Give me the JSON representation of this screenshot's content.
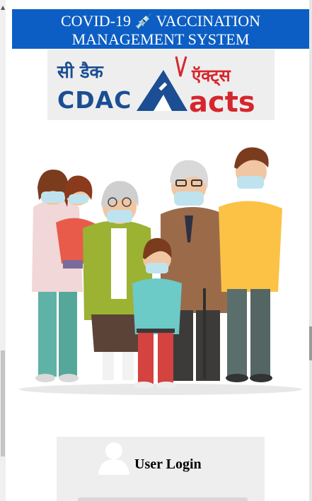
{
  "app": {
    "header_line1": "COVID-19",
    "header_line1b": "VACCINATION",
    "header_line2": "MANAGEMENT SYSTEM"
  },
  "logos": {
    "cdac_hindi": "सी डैक",
    "cdac_english": "CDAC",
    "acts_hindi": "ऍक्ट्स",
    "acts_english": "acts"
  },
  "login": {
    "title": "User Login"
  },
  "colors": {
    "header_bg": "#0c5ec4",
    "cdac_blue": "#1b4e93",
    "acts_red": "#d6262d"
  },
  "icons": [
    "syringe-icon",
    "user-icon"
  ]
}
